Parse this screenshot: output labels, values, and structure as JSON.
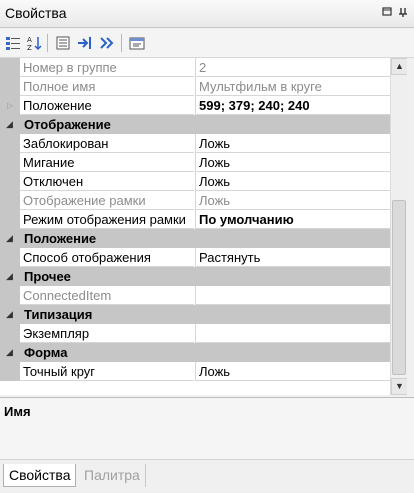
{
  "panel": {
    "title": "Свойства",
    "pin_glyph": "ㅁ",
    "close_glyph": "✕"
  },
  "toolbar": {
    "icons": [
      "categorized-icon",
      "alphabetical-icon",
      "properties-icon",
      "jump-to-icon",
      "navigate-icon",
      "property-pages-icon"
    ]
  },
  "grid": {
    "rows": [
      {
        "kind": "prop",
        "name": "Номер в группе",
        "value": "2",
        "dim": true
      },
      {
        "kind": "prop",
        "name": "Полное имя",
        "value": "Мультфильм в круге",
        "dim": true
      },
      {
        "kind": "prop",
        "name": "Положение",
        "value": "599; 379; 240; 240",
        "bold": true,
        "expandable": true
      },
      {
        "kind": "cat",
        "name": "Отображение"
      },
      {
        "kind": "prop",
        "name": "Заблокирован",
        "value": "Ложь"
      },
      {
        "kind": "prop",
        "name": "Мигание",
        "value": "Ложь"
      },
      {
        "kind": "prop",
        "name": "Отключен",
        "value": "Ложь"
      },
      {
        "kind": "prop",
        "name": "Отображение рамки",
        "value": "Ложь",
        "dim": true
      },
      {
        "kind": "prop",
        "name": "Режим отображения рамки",
        "value": "По умолчанию",
        "bold": true
      },
      {
        "kind": "cat",
        "name": "Положение"
      },
      {
        "kind": "prop",
        "name": "Способ отображения",
        "value": "Растянуть"
      },
      {
        "kind": "cat",
        "name": "Прочее"
      },
      {
        "kind": "prop",
        "name": "ConnectedItem",
        "value": "",
        "dim": true
      },
      {
        "kind": "cat",
        "name": "Типизация"
      },
      {
        "kind": "prop",
        "name": "Экземпляр",
        "value": ""
      },
      {
        "kind": "cat",
        "name": "Форма"
      },
      {
        "kind": "prop",
        "name": "Точный круг",
        "value": "Ложь"
      }
    ]
  },
  "description": {
    "title": "Имя"
  },
  "tabs": [
    {
      "label": "Свойства",
      "active": true
    },
    {
      "label": "Палитра",
      "active": false
    }
  ],
  "colors": {
    "category_bg": "#c6c6c6",
    "grid_line": "#d6d6d6",
    "dim_text": "#8c8c8c",
    "toolbar_blue": "#2a62c9"
  }
}
